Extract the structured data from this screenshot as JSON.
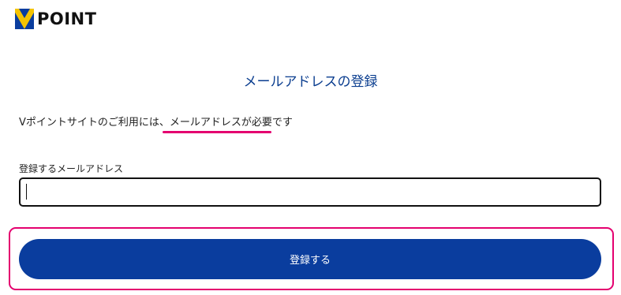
{
  "header": {
    "logo_text": "POINT",
    "logo_icon": "v-point-logo-icon",
    "logo_colors": {
      "blue": "#0a3d9e",
      "yellow": "#f5c400"
    }
  },
  "main": {
    "title": "メールアドレスの登録",
    "notice_prefix": "Vポイントサイトのご利用には、",
    "notice_highlight": "メールアドレスが必要",
    "notice_suffix": "です",
    "email_label": "登録するメールアドレス",
    "email_value": "",
    "email_placeholder": "",
    "submit_label": "登録する"
  },
  "colors": {
    "accent": "#0a3d9e",
    "title": "#0a3d8f",
    "highlight": "#e4006f"
  }
}
